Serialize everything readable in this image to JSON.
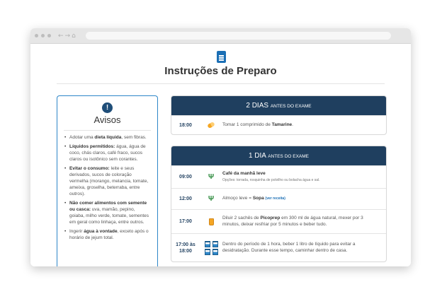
{
  "page": {
    "title": "Instruções de Preparo",
    "icon": "document-icon"
  },
  "avisos": {
    "icon": "!",
    "title": "Avisos",
    "items": [
      {
        "pre": "Adotar uma ",
        "bold": "dieta líquida",
        "post": ", sem fibras."
      },
      {
        "pre": "",
        "bold": "Líquidos permitidos:",
        "post": " água, água de coco, chás claros, café fraco, sucos claros ou isotônico sem corantes."
      },
      {
        "pre": "",
        "bold": "Evitar o consumo:",
        "post": " leite e seus derivados, sucos de coloração vermelha (morango, melancia, tomate, ameixa, groselha, beterraba, entre outros)."
      },
      {
        "pre": "",
        "bold": "Não comer alimentos com semente ou casca:",
        "post": " uva, mamão, pepino, goiaba, milho verde, tomate, sementes em geral como linhaça, entre outros."
      },
      {
        "pre": "Ingerir ",
        "bold": "água à vontade",
        "post": ", exceto após o horário de jejum total."
      }
    ]
  },
  "days": [
    {
      "big": "2 DIAS",
      "small": "ANTES DO EXAME",
      "rows": [
        {
          "time": "18:00",
          "icon": "pill-icon",
          "pre": "Tomar 1 comprimido de ",
          "bold": "Tamarine",
          "post": "."
        }
      ]
    },
    {
      "big": "1 DIA",
      "small": "ANTES DO EXAME",
      "rows": [
        {
          "time": "09:00",
          "icon": "cutlery-icon",
          "bold": "Café da manhã leve",
          "sub": "Opções: torrada, rosquinha de polvilho ou bolacha água e sal."
        },
        {
          "time": "12:00",
          "icon": "cutlery-icon",
          "pre": "Almoço leve = ",
          "bold": "Sopa",
          "link": "(ver receita)"
        },
        {
          "time": "17:00",
          "icon": "jar-icon",
          "pre": "Diluir 2 sachês de ",
          "bold": "Picoprep",
          "post": " em 300 ml de água natural, mexer por 3 minutos, deixar resfriar por 5 minutos e beber tudo."
        },
        {
          "time": "17:00 às 18:00",
          "icon": "water-cups-icon",
          "pre": "Dentro do período de 1 hora, beber 1 litro de líquido para evitar a desidratação. Durante esse tempo, caminhar dentro de casa."
        }
      ]
    }
  ]
}
